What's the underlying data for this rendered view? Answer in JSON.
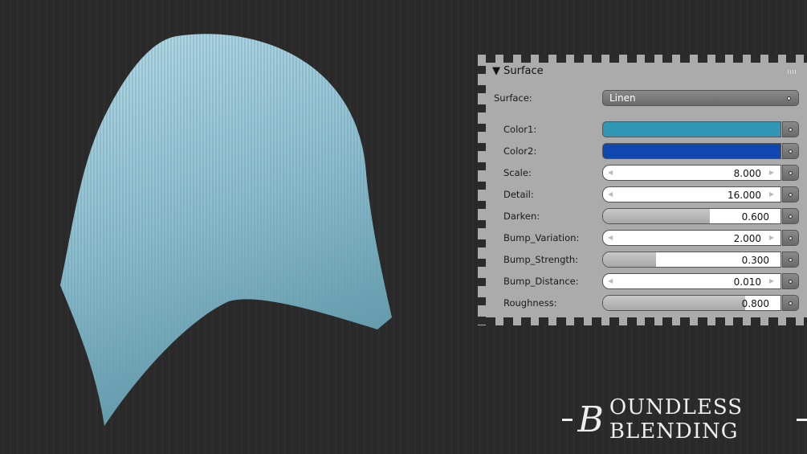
{
  "panel": {
    "title": "Surface",
    "surface_label": "Surface:",
    "surface_value": "Linen",
    "rows": [
      {
        "label": "Color1:",
        "type": "color",
        "color": "#2f97b5"
      },
      {
        "label": "Color2:",
        "type": "color",
        "color": "#1148b0"
      },
      {
        "label": "Scale:",
        "type": "number",
        "value": "8.000"
      },
      {
        "label": "Detail:",
        "type": "number",
        "value": "16.000"
      },
      {
        "label": "Darken:",
        "type": "slider",
        "value": "0.600",
        "fraction": 0.6
      },
      {
        "label": "Bump_Variation:",
        "type": "number",
        "value": "2.000"
      },
      {
        "label": "Bump_Strength:",
        "type": "slider",
        "value": "0.300",
        "fraction": 0.3
      },
      {
        "label": "Bump_Distance:",
        "type": "number",
        "value": "0.010"
      },
      {
        "label": "Roughness:",
        "type": "slider",
        "value": "0.800",
        "fraction": 0.8
      }
    ]
  },
  "logo": {
    "text": "BOUNDLESS BLENDING"
  }
}
